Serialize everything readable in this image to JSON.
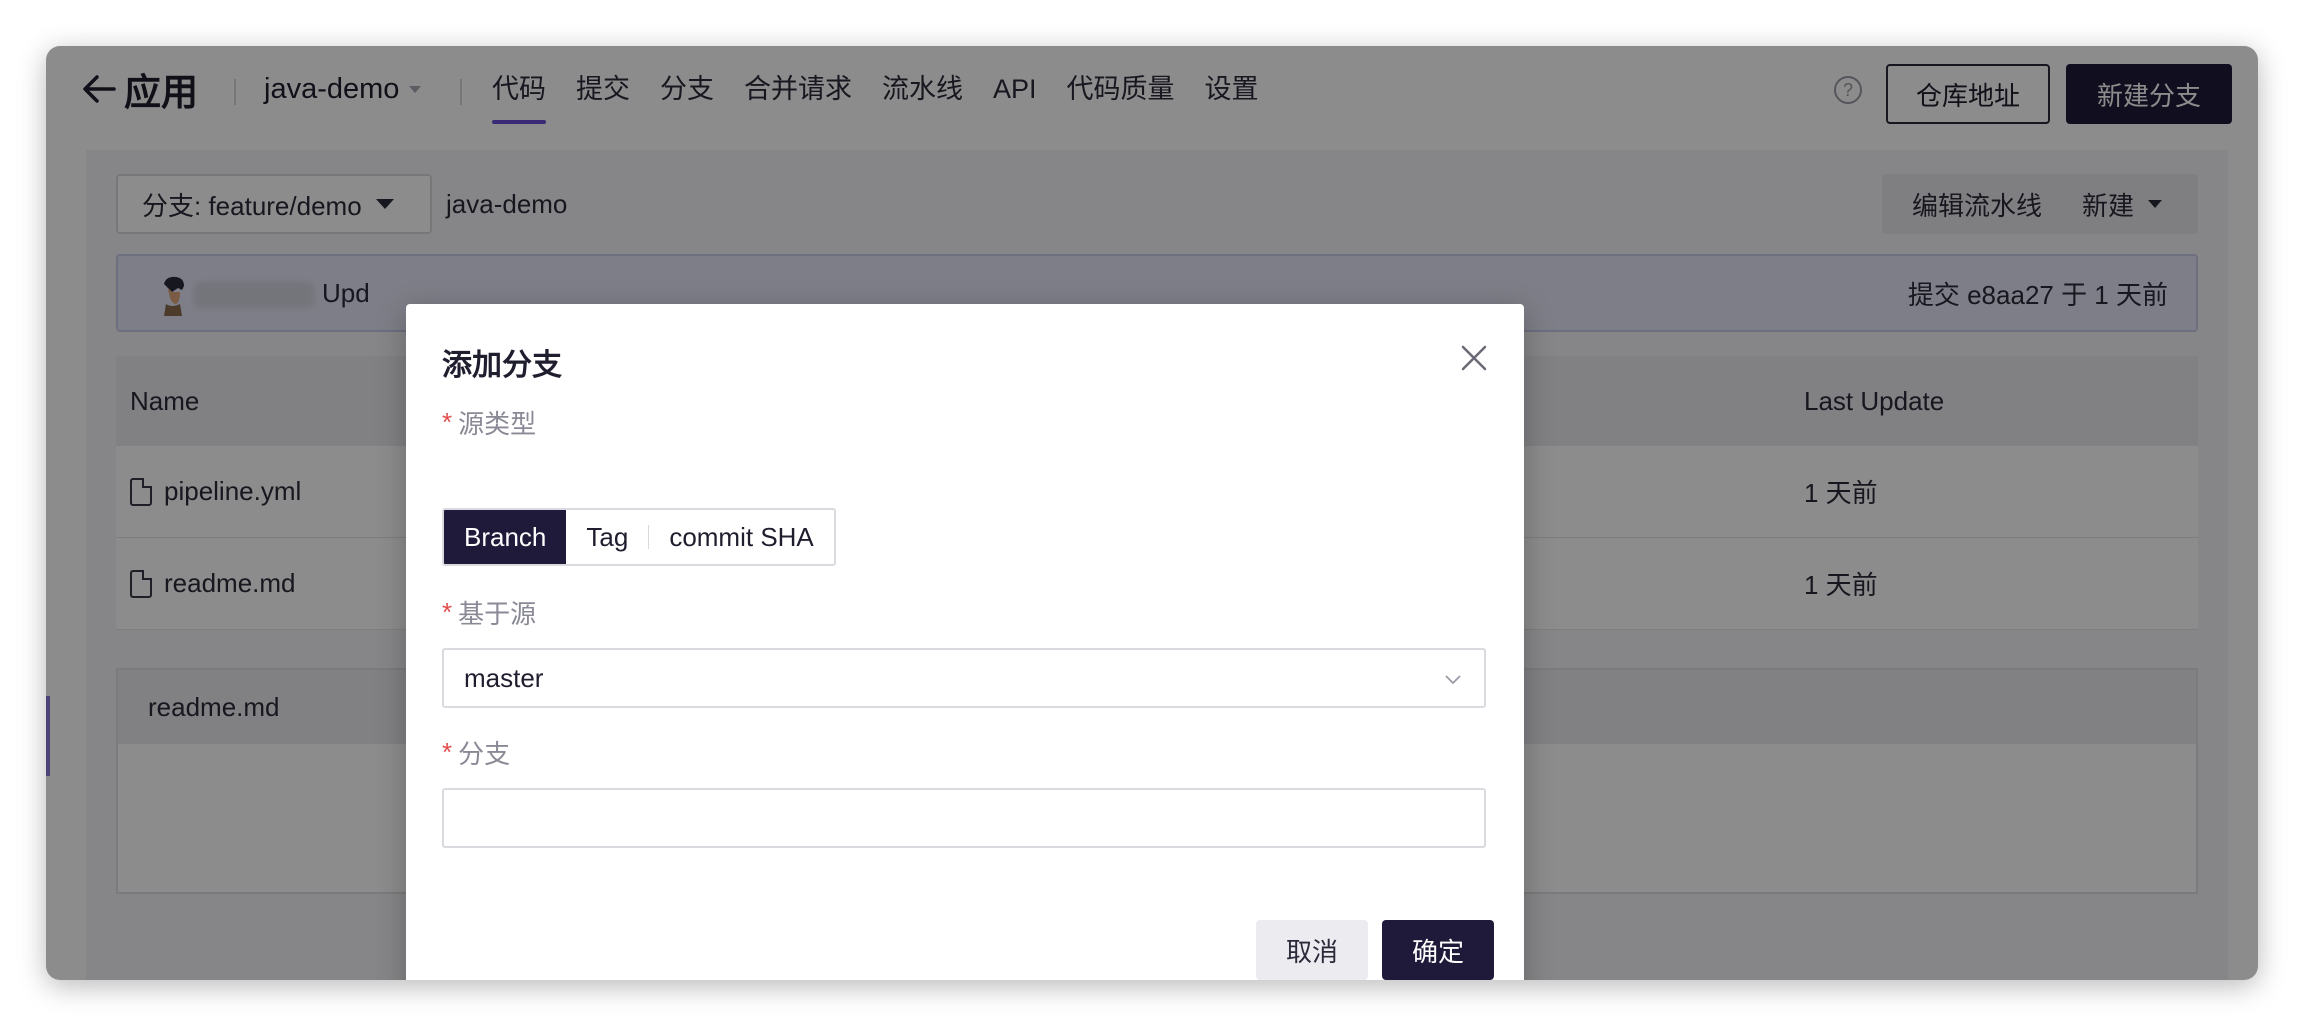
{
  "header": {
    "back_label": "应用",
    "project_name": "java-demo",
    "tabs": [
      {
        "label": "代码",
        "active": true
      },
      {
        "label": "提交",
        "active": false
      },
      {
        "label": "分支",
        "active": false
      },
      {
        "label": "合并请求",
        "active": false
      },
      {
        "label": "流水线",
        "active": false
      },
      {
        "label": "API",
        "active": false
      },
      {
        "label": "代码质量",
        "active": false
      },
      {
        "label": "设置",
        "active": false
      }
    ],
    "help_icon": "?",
    "repo_address_label": "仓库地址",
    "new_branch_label": "新建分支"
  },
  "toolbar": {
    "branch_select_label": "分支: feature/demo",
    "repo_path": "java-demo",
    "edit_pipeline_label": "编辑流水线",
    "new_label": "新建"
  },
  "commit_bar": {
    "message_prefix": "Upd",
    "commit_info": "提交 e8aa27 于 1 天前"
  },
  "file_table": {
    "columns": {
      "name": "Name",
      "last_update": "Last Update"
    },
    "rows": [
      {
        "name": "pipeline.yml",
        "last_update": "1 天前"
      },
      {
        "name": "readme.md",
        "last_update": "1 天前"
      }
    ]
  },
  "readme": {
    "title": "readme.md"
  },
  "modal": {
    "title": "添加分支",
    "required_mark": "*",
    "source_type_label": "源类型",
    "source_types": [
      {
        "label": "Branch",
        "active": true
      },
      {
        "label": "Tag",
        "active": false
      },
      {
        "label": "commit SHA",
        "active": false
      }
    ],
    "based_on_label": "基于源",
    "based_on_value": "master",
    "branch_label": "分支",
    "branch_value": "",
    "cancel_label": "取消",
    "confirm_label": "确定"
  },
  "colors": {
    "accent": "#6a4bd6",
    "primary_dark": "#1f1a3a",
    "required": "#e34c4c"
  }
}
